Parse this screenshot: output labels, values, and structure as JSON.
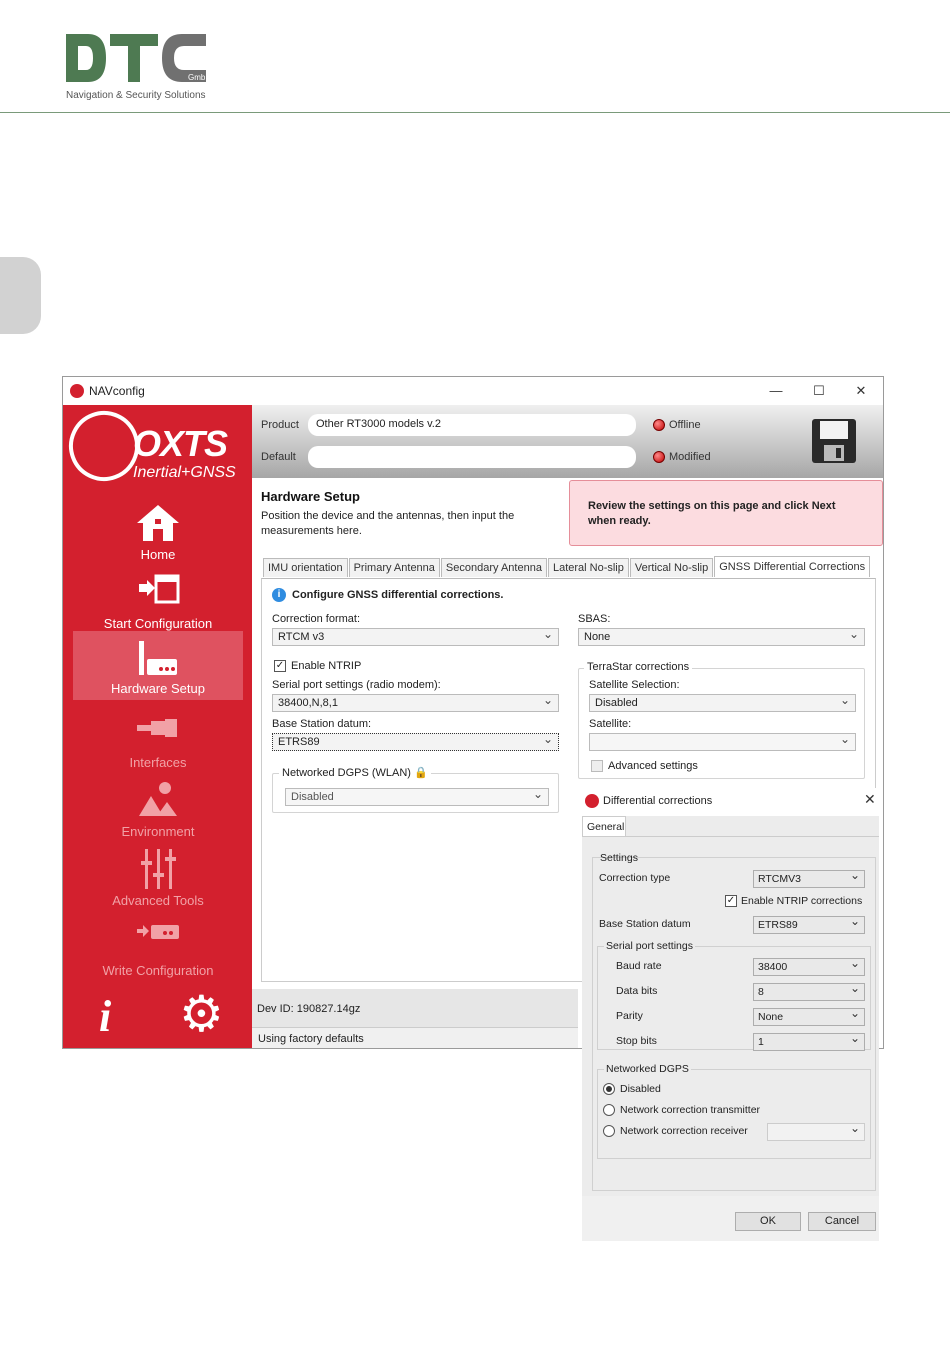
{
  "page": {
    "logo_text": "DTC",
    "logo_suffix": "GmbH",
    "logo_tagline": "Navigation & Security Solutions"
  },
  "window": {
    "title": "NAVconfig",
    "controls": {
      "minimize": "—",
      "maximize": "☐",
      "close": "✕"
    }
  },
  "sidebar": {
    "brand": "OXTS",
    "brand_sub": "Inertial+GNSS",
    "items": [
      {
        "label": "Home",
        "icon": "home-icon"
      },
      {
        "label": "Start Configuration",
        "icon": "start-config-icon"
      },
      {
        "label": "Hardware Setup",
        "icon": "hardware-icon"
      },
      {
        "label": "Interfaces",
        "icon": "interfaces-icon"
      },
      {
        "label": "Environment",
        "icon": "environment-icon"
      },
      {
        "label": "Advanced Tools",
        "icon": "sliders-icon"
      },
      {
        "label": "Write Configuration",
        "icon": "write-config-icon"
      }
    ],
    "info_glyph": "i",
    "settings_glyph": "⚙"
  },
  "topband": {
    "product_label": "Product",
    "product_value": "Other RT3000 models v.2",
    "default_label": "Default",
    "default_value": "",
    "status_offline": "Offline",
    "status_modified": "Modified"
  },
  "hardware": {
    "title": "Hardware Setup",
    "description": "Position the device and the antennas, then input the measurements here.",
    "notice": "Review the settings on this page and click Next when ready."
  },
  "tabs": [
    "IMU orientation",
    "Primary Antenna",
    "Secondary Antenna",
    "Lateral No-slip",
    "Vertical No-slip",
    "GNSS Differential Corrections"
  ],
  "gnss": {
    "intro": "Configure GNSS differential corrections.",
    "correction_format_label": "Correction format:",
    "correction_format_value": "RTCM v3",
    "enable_ntrip_label": "Enable NTRIP",
    "serial_label": "Serial port settings (radio modem):",
    "serial_value": "38400,N,8,1",
    "datum_label": "Base Station datum:",
    "datum_value": "ETRS89",
    "networked_label": "Networked DGPS (WLAN)",
    "networked_value": "Disabled",
    "sbas_label": "SBAS:",
    "sbas_value": "None",
    "terrastar_label": "TerraStar corrections",
    "satsel_label": "Satellite Selection:",
    "satsel_value": "Disabled",
    "satellite_label": "Satellite:",
    "satellite_value": "",
    "advanced_label": "Advanced settings"
  },
  "footer": {
    "devid": "Dev ID: 190827.14gz",
    "factory": "Using factory defaults"
  },
  "dialog": {
    "title": "Differential corrections",
    "tab": "General",
    "settings_label": "Settings",
    "correction_type_label": "Correction type",
    "correction_type_value": "RTCMV3",
    "enable_ntrip_label": "Enable NTRIP corrections",
    "datum_label": "Base Station datum",
    "datum_value": "ETRS89",
    "serial_group": "Serial port settings",
    "baud_label": "Baud rate",
    "baud_value": "38400",
    "databits_label": "Data bits",
    "databits_value": "8",
    "parity_label": "Parity",
    "parity_value": "None",
    "stopbits_label": "Stop bits",
    "stopbits_value": "1",
    "networked_group": "Networked DGPS",
    "radio_disabled": "Disabled",
    "radio_transmitter": "Network correction transmitter",
    "radio_receiver": "Network correction receiver",
    "ok": "OK",
    "cancel": "Cancel"
  },
  "colors": {
    "brand_red": "#d3202e",
    "logo_green": "#4e7a52",
    "logo_grey": "#707070"
  }
}
